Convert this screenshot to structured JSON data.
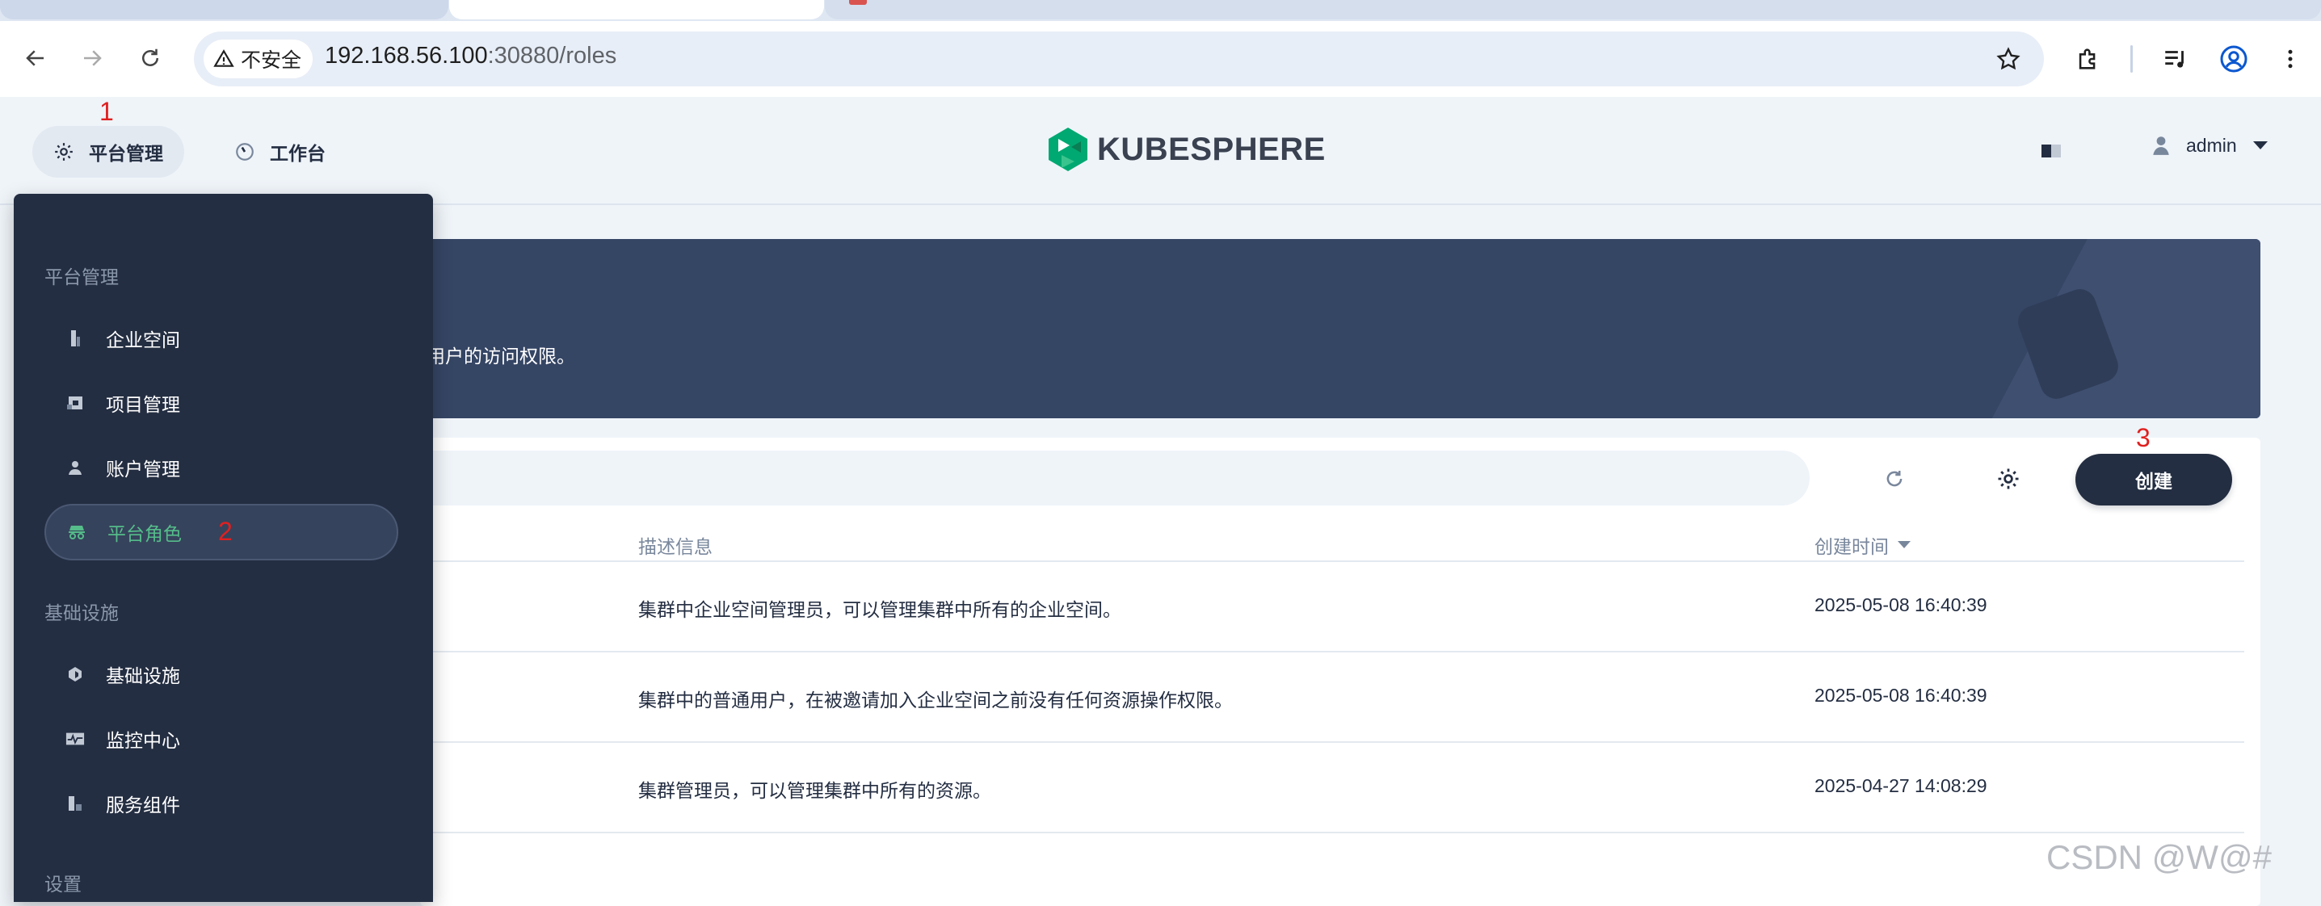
{
  "browser": {
    "security_label": "不安全",
    "url_host": "192.168.56.100",
    "url_path": ":30880/roles"
  },
  "header": {
    "nav": [
      {
        "label": "平台管理",
        "icon": "gear-icon",
        "active": true
      },
      {
        "label": "工作台",
        "icon": "dashboard-icon",
        "active": false
      }
    ],
    "logo_text": "KUBESPHERE",
    "user_name": "admin"
  },
  "annotations": {
    "step1": "1",
    "step2": "2",
    "step3": "3"
  },
  "platform_menu": {
    "sections": [
      {
        "title": "平台管理",
        "items": [
          {
            "label": "企业空间",
            "icon": "workspace-icon"
          },
          {
            "label": "项目管理",
            "icon": "project-icon"
          },
          {
            "label": "账户管理",
            "icon": "user-icon"
          },
          {
            "label": "平台角色",
            "icon": "role-icon",
            "active": true
          }
        ]
      },
      {
        "title": "基础设施",
        "items": [
          {
            "label": "基础设施",
            "icon": "cluster-icon"
          },
          {
            "label": "监控中心",
            "icon": "monitor-icon"
          },
          {
            "label": "服务组件",
            "icon": "components-icon"
          }
        ]
      },
      {
        "title": "设置",
        "items": []
      }
    ]
  },
  "banner": {
    "description_partial": "用户的访问权限。"
  },
  "toolbar": {
    "create_label": "创建"
  },
  "table": {
    "columns": [
      "描述信息",
      "创建时间"
    ],
    "sort_column": "创建时间",
    "rows": [
      {
        "description": "集群中企业空间管理员，可以管理集群中所有的企业空间。",
        "created": "2025-05-08 16:40:39"
      },
      {
        "description": "集群中的普通用户，在被邀请加入企业空间之前没有任何资源操作权限。",
        "created": "2025-05-08 16:40:39"
      },
      {
        "description": "集群管理员，可以管理集群中所有的资源。",
        "created": "2025-04-27 14:08:29"
      }
    ]
  },
  "watermark": "CSDN @W@#",
  "colors": {
    "accent": "#55bc8a",
    "dark": "#242e42",
    "banner": "#354564",
    "annotation": "#e02020"
  }
}
